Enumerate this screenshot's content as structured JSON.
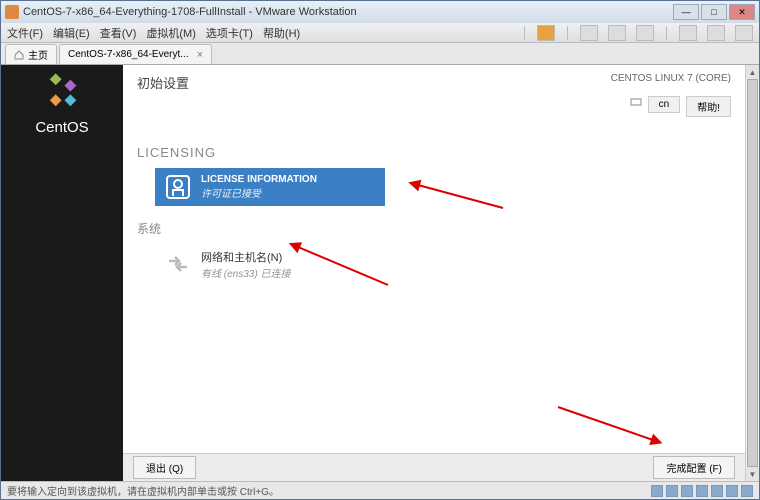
{
  "window": {
    "title": "CentOS-7-x86_64-Everything-1708-FullInstall - VMware Workstation"
  },
  "menu": {
    "file": "文件(F)",
    "edit": "编辑(E)",
    "view": "查看(V)",
    "vm": "虚拟机(M)",
    "tabs": "选项卡(T)",
    "help": "帮助(H)"
  },
  "tabs": {
    "home": "主页",
    "vm_tab": "CentOS-7-x86_64-Everyt..."
  },
  "sidebar": {
    "brand": "CentOS"
  },
  "setup": {
    "title": "初始设置",
    "distro": "CENTOS LINUX 7 (CORE)",
    "lang_indicator": "cn",
    "help_button": "帮助!",
    "licensing_section": "LICENSING",
    "license_card": {
      "title": "LICENSE INFORMATION",
      "subtitle": "许可证已接受"
    },
    "system_section": "系统",
    "network_card": {
      "title": "网络和主机名(N)",
      "subtitle": "有线 (ens33) 已连接"
    },
    "footer": {
      "quit": "退出 (Q)",
      "finish": "完成配置 (F)"
    }
  },
  "statusbar": {
    "hint": "要将输入定向到该虚拟机，请在虚拟机内部单击或按 Ctrl+G。"
  }
}
